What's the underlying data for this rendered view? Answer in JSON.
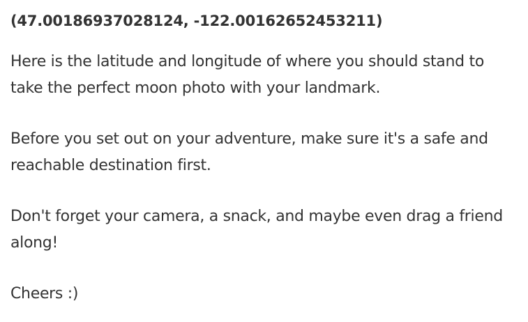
{
  "message": {
    "coordinates": "(47.00186937028124, -122.00162652453211)",
    "paragraphs": [
      "Here is the latitude and longitude of where you should stand to take the perfect moon photo with your landmark.",
      "Before you set out on your adventure, make sure it's a safe and reachable destination first.",
      "Don't forget your camera, a snack, and maybe even drag a friend along!",
      "Cheers :)"
    ]
  }
}
